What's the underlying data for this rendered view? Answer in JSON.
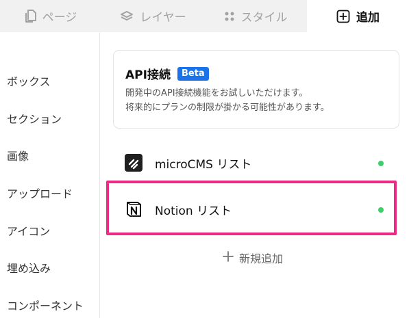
{
  "tabs": [
    {
      "label": "ページ",
      "icon": "page-icon"
    },
    {
      "label": "レイヤー",
      "icon": "layers-icon"
    },
    {
      "label": "スタイル",
      "icon": "style-dots-icon"
    },
    {
      "label": "追加",
      "icon": "plus-square-icon",
      "active": true
    }
  ],
  "sidebar": {
    "items": [
      {
        "label": "ボックス"
      },
      {
        "label": "セクション"
      },
      {
        "label": "画像"
      },
      {
        "label": "アップロード"
      },
      {
        "label": "アイコン"
      },
      {
        "label": "埋め込み"
      },
      {
        "label": "コンポーネント"
      }
    ]
  },
  "api_card": {
    "title": "API接続",
    "badge": "Beta",
    "description_line1": "開発中のAPI接続機能をお試しいただけます。",
    "description_line2": "将来的にプランの制限が掛かる可能性があります。"
  },
  "connections": [
    {
      "label": "microCMS リスト",
      "icon": "microcms-logo-icon",
      "status_color": "#3ccf6b"
    },
    {
      "label": "Notion リスト",
      "icon": "notion-logo-icon",
      "status_color": "#3ccf6b"
    }
  ],
  "add_new": {
    "label": "新規追加"
  },
  "colors": {
    "accent": "#1a73e8",
    "highlight": "#ee2a87",
    "status_green": "#3ccf6b"
  }
}
